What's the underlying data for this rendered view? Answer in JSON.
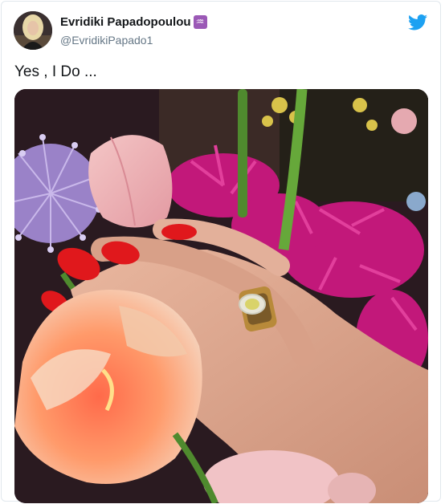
{
  "author": {
    "display_name": "Evridiki Papadopoulou",
    "badge": "♒",
    "handle": "@EvridikiPapado1"
  },
  "tweet": {
    "text": "Yes , I Do ..."
  },
  "icons": {
    "logo": "twitter-bird-icon",
    "badge": "aquarius-icon"
  },
  "colors": {
    "twitter_blue": "#1da1f2",
    "text": "#14171a",
    "secondary_text": "#657786",
    "badge": "#9b59b6"
  }
}
